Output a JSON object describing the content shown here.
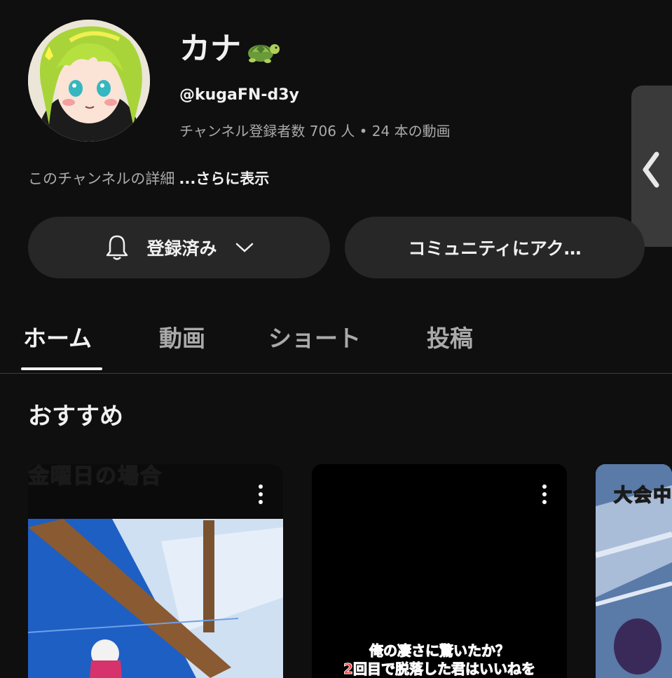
{
  "channel": {
    "name": "カナ",
    "name_emoji": "turtle",
    "handle": "@kugaFN-d3y",
    "stats": "チャンネル登録者数 706 人 • 24 本の動画",
    "description": "このチャンネルの詳細",
    "description_more": "...さらに表示"
  },
  "actions": {
    "subscribed_label": "登録済み",
    "community_label": "コミュニティにアク…"
  },
  "tabs": [
    {
      "label": "ホーム",
      "active": true
    },
    {
      "label": "動画",
      "active": false
    },
    {
      "label": "ショート",
      "active": false
    },
    {
      "label": "投稿",
      "active": false
    }
  ],
  "section": {
    "title": "おすすめ"
  },
  "videos": [
    {
      "overlay_text": "金曜日の場合"
    },
    {
      "caption_line1": "俺の凄さに驚いたか？",
      "caption_line2": "2回目で脱落した君はいいねを"
    },
    {
      "overlay_text": "大会中"
    }
  ],
  "icons": {
    "bell": "bell-icon",
    "chevron": "chevron-down-icon",
    "side_collapse": "chevron-left-icon",
    "more": "more-vert-icon"
  },
  "colors": {
    "background": "#0f0f0f",
    "button_bg": "#272727",
    "text_primary": "#f1f1f1",
    "text_secondary": "#aaaaaa"
  }
}
